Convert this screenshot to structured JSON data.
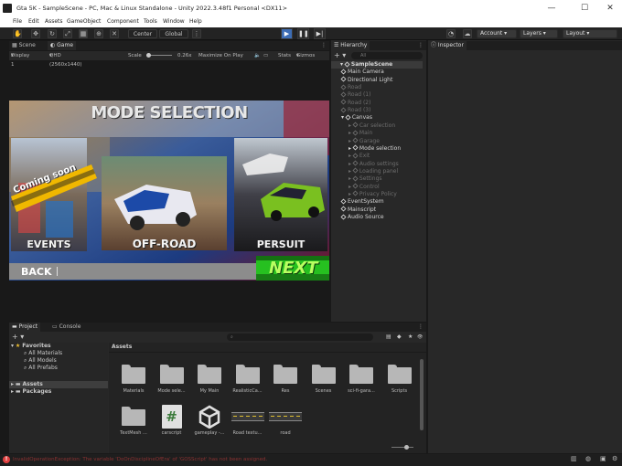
{
  "window": {
    "title": "Gta 5K - SampleScene - PC, Mac & Linux Standalone - Unity 2022.3.48f1 Personal <DX11>",
    "minimize": "—",
    "maximize": "☐",
    "close": "✕"
  },
  "menu": [
    "File",
    "Edit",
    "Assets",
    "GameObject",
    "Component",
    "Tools",
    "Window",
    "Help"
  ],
  "toolbar": {
    "center": "Center",
    "global": "Global",
    "account": "Account",
    "layers": "Layers",
    "layout": "Layout"
  },
  "scene_tabs": {
    "scene": "Scene",
    "game": "Game"
  },
  "game_controls": {
    "display": "Display 1",
    "resolution": "QHD (2560x1440)",
    "scale_label": "Scale",
    "scale_value": "0.26x",
    "maximize": "Maximize On Play",
    "stats": "Stats",
    "gizmos": "Gizmos"
  },
  "game": {
    "title": "MODE SELECTION",
    "coming_soon": "Coming soon",
    "events": "EVENTS",
    "offroad": "OFF-ROAD",
    "persuit": "PERSUIT",
    "back": "BACK",
    "next": "NEXT"
  },
  "hierarchy": {
    "tab": "Hierarchy",
    "search_placeholder": "All",
    "items": [
      {
        "label": "SampleScene",
        "indent": 0,
        "type": "scene",
        "active": true
      },
      {
        "label": "Main Camera",
        "indent": 1,
        "active": true
      },
      {
        "label": "Directional Light",
        "indent": 1,
        "active": true
      },
      {
        "label": "Road",
        "indent": 1,
        "active": false
      },
      {
        "label": "Road (1)",
        "indent": 1,
        "active": false
      },
      {
        "label": "Road (2)",
        "indent": 1,
        "active": false
      },
      {
        "label": "Road (3)",
        "indent": 1,
        "active": false
      },
      {
        "label": "Canvas",
        "indent": 1,
        "active": true,
        "expanded": true
      },
      {
        "label": "Car selection",
        "indent": 2,
        "active": false
      },
      {
        "label": "Main",
        "indent": 2,
        "active": false
      },
      {
        "label": "Garage",
        "indent": 2,
        "active": false
      },
      {
        "label": "Mode selection",
        "indent": 2,
        "active": true
      },
      {
        "label": "Exit",
        "indent": 2,
        "active": false
      },
      {
        "label": "Audio settings",
        "indent": 2,
        "active": false
      },
      {
        "label": "Loading panel",
        "indent": 2,
        "active": false
      },
      {
        "label": "Settings",
        "indent": 2,
        "active": false
      },
      {
        "label": "Control",
        "indent": 2,
        "active": false
      },
      {
        "label": "Privacy Policy",
        "indent": 2,
        "active": false
      },
      {
        "label": "EventSystem",
        "indent": 1,
        "active": true
      },
      {
        "label": "Mainscript",
        "indent": 1,
        "active": true
      },
      {
        "label": "Audio Source",
        "indent": 1,
        "active": true
      }
    ]
  },
  "inspector": {
    "tab": "Inspector"
  },
  "project": {
    "tab_project": "Project",
    "tab_console": "Console",
    "favorites": "Favorites",
    "fav_items": [
      "All Materials",
      "All Models",
      "All Prefabs"
    ],
    "assets": "Assets",
    "packages": "Packages",
    "breadcrumb": "Assets",
    "count": "17",
    "asset_items": [
      {
        "label": "Materials",
        "kind": "folder"
      },
      {
        "label": "Mode sele...",
        "kind": "folder"
      },
      {
        "label": "My Main",
        "kind": "folder"
      },
      {
        "label": "RealisticCa...",
        "kind": "folder"
      },
      {
        "label": "Res",
        "kind": "folder"
      },
      {
        "label": "Scenes",
        "kind": "folder"
      },
      {
        "label": "sci-fi-gara...",
        "kind": "folder"
      },
      {
        "label": "Scripts",
        "kind": "folder"
      },
      {
        "label": "TextMesh ...",
        "kind": "folder"
      },
      {
        "label": "carscript",
        "kind": "script"
      },
      {
        "label": "gameplay -...",
        "kind": "unity"
      },
      {
        "label": "Road textu...",
        "kind": "road"
      },
      {
        "label": "road",
        "kind": "road"
      }
    ]
  },
  "status": {
    "error": "InvalidOperationException: The variable 'DoOnDisciplineOfEra' of 'GOSScript' has not been assigned."
  },
  "colors": {
    "accent": "#3d6db5",
    "error": "#e04040",
    "folder": "#b7b7b7"
  }
}
